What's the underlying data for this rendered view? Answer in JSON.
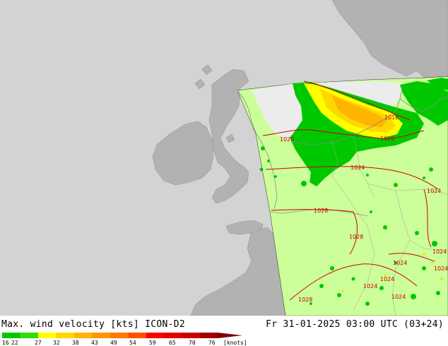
{
  "header": {
    "title_left": "Max. wind velocity [kts] ICON-D2",
    "title_right": "Fr 31-01-2025 03:00 UTC (03+24)"
  },
  "legend": {
    "ticks": [
      "16",
      "22",
      "27",
      "32",
      "38",
      "43",
      "49",
      "54",
      "59",
      "65",
      "70",
      "76",
      "[knots]"
    ],
    "colors": [
      "#00c800",
      "#32dc00",
      "#ffff00",
      "#ffd700",
      "#ffb400",
      "#ff9600",
      "#ff7800",
      "#ff5000",
      "#ff0000",
      "#e10000",
      "#c80000",
      "#a00000",
      "#800000"
    ]
  },
  "map": {
    "isobar_labels": [
      "1016",
      "1020",
      "1020",
      "1024",
      "1024",
      "1028",
      "1028",
      "1024",
      "1024",
      "1024",
      "1024",
      "1024",
      "1024",
      "1028"
    ],
    "colors": {
      "sea": "#d3d3d3",
      "land_outside": "#b2b2b2",
      "domain_calm": "#ccff99",
      "domain_sea_calm": "#ececec",
      "isobar": "#cc0000",
      "coastline": "#8a8a8a"
    }
  }
}
